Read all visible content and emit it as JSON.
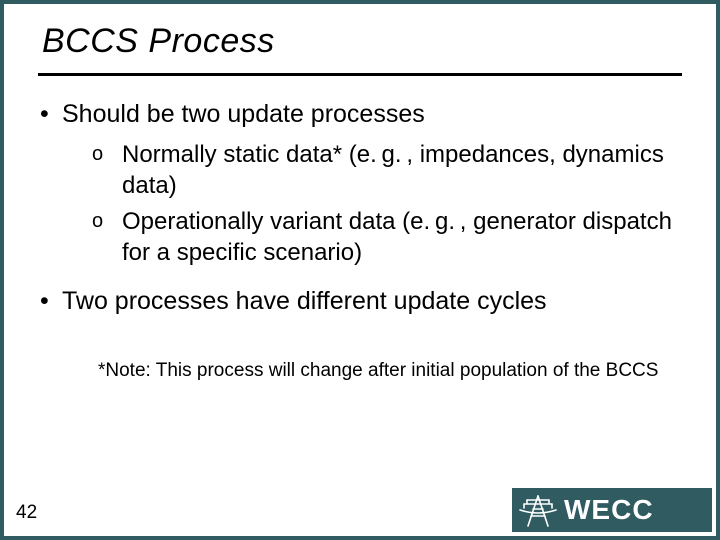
{
  "title": "BCCS Process",
  "bullets": {
    "b0": "Should be two update processes",
    "b1": "Two processes have different update cycles"
  },
  "sub": {
    "s0": "Normally static data* (e. g. , impedances, dynamics data)",
    "s1": "Operationally variant data (e. g. , generator dispatch for a specific scenario)"
  },
  "note": "*Note: This process will change after initial population of the BCCS",
  "page_number": "42",
  "logo_text": "WECC"
}
